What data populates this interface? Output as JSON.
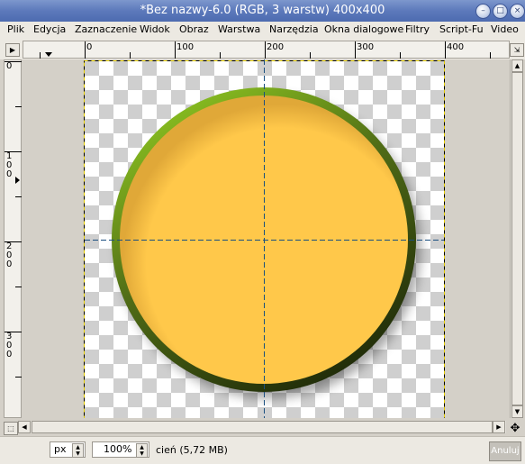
{
  "window": {
    "title": "*Bez nazwy-6.0 (RGB, 3 warstw) 400x400",
    "controls": [
      "minimize",
      "maximize",
      "close"
    ]
  },
  "menubar": {
    "items": [
      "Plik",
      "Edycja",
      "Zaznaczenie",
      "Widok",
      "Obraz",
      "Warstwa",
      "Narzędzia",
      "Okna dialogowe",
      "Filtry",
      "Script-Fu",
      "Video"
    ]
  },
  "rulers": {
    "horizontal_labels": [
      "0",
      "100",
      "200",
      "300",
      "400"
    ],
    "vertical_labels": [
      "0",
      "100",
      "200",
      "300"
    ]
  },
  "image": {
    "circle_fill": "#ffc84a",
    "rim_top": "#8ec621",
    "rim_bottom": "#1b2508",
    "guide_color": "#1b4f80",
    "border_color": "#e8d000"
  },
  "status": {
    "unit": "px",
    "zoom": "100%",
    "layer_info": "cień (5,72 MB)",
    "cancel_label": "Anuluj"
  }
}
